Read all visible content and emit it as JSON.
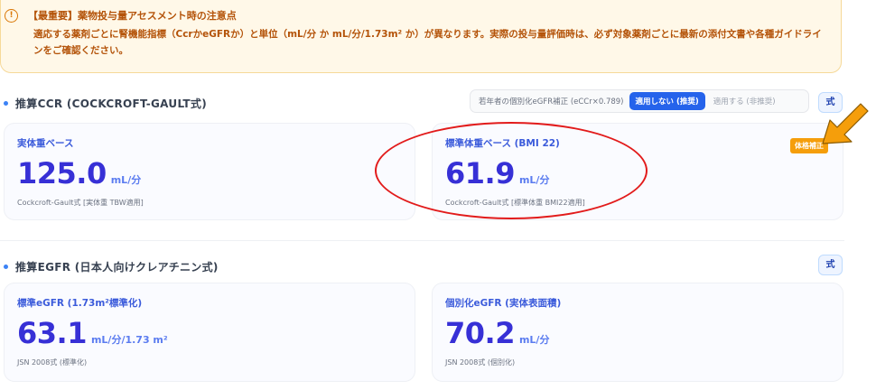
{
  "notice": {
    "icon": "info-icon",
    "icon_glyph": "!",
    "title": "【最重要】薬物投与量アセスメント時の注意点",
    "body": "適応する薬剤ごとに腎機能指標（CcrかeGFRか）と単位（mL/分 か mL/分/1.73m² か）が異なります。実際の投与量評価時は、必ず対象薬剤ごとに最新の添付文書や各種ガイドラインをご確認ください。"
  },
  "ccr_section": {
    "title": "推算CCR (COCKCROFT-GAULT式)",
    "toggle_label": "若年者の個別化eGFR補正 (eCCr×0.789)",
    "toggle_on": "適用しない (推奨)",
    "toggle_off": "適用する (非推奨)",
    "formula_button": "式",
    "cards": [
      {
        "label": "実体重ベース",
        "value": "125.0",
        "unit": "mL/分",
        "foot": "Cockcroft-Gault式 [実体重 TBW適用]"
      },
      {
        "label": "標準体重ベース (BMI 22)",
        "value": "61.9",
        "unit": "mL/分",
        "foot": "Cockcroft-Gault式 [標準体重 BMI22適用]",
        "badge": "体格補正"
      }
    ]
  },
  "egfr_section": {
    "title": "推算EGFR (日本人向けクレアチニン式)",
    "formula_button": "式",
    "cards": [
      {
        "label": "標準eGFR (1.73m²標準化)",
        "value": "63.1",
        "unit": "mL/分/1.73 m²",
        "foot": "JSN 2008式 (標準化)"
      },
      {
        "label": "個別化eGFR (実体表面積)",
        "value": "70.2",
        "unit": "mL/分",
        "foot": "JSN 2008式 (個別化)"
      }
    ]
  },
  "colors": {
    "accent": "#2563eb",
    "value": "#3730d6",
    "warning": "#b45309",
    "badge": "#f59e0b",
    "annotation": "#e21b1b"
  }
}
